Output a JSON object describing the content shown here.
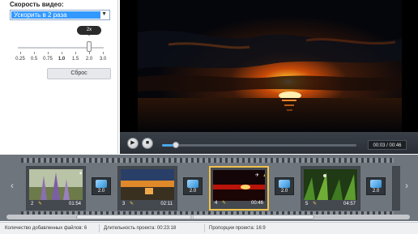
{
  "settings": {
    "speed_label": "Скорость видео:",
    "speed_value": "Ускорить в 2 раза",
    "tooltip": "2x",
    "scale": [
      "0.25",
      "0.5",
      "0.75",
      "1.0",
      "1.5",
      "2.0",
      "3.0"
    ],
    "reset_label": "Сброс"
  },
  "player": {
    "time": "00:03 / 00:46",
    "progress": 0.07
  },
  "storyboard": {
    "clips": [
      {
        "number": "2",
        "duration": "01:54"
      },
      {
        "number": "3",
        "duration": "02:11"
      },
      {
        "number": "4",
        "duration": "00:46"
      },
      {
        "number": "5",
        "duration": "04:57"
      }
    ],
    "transitions": [
      "2.0",
      "2.0",
      "2.0",
      "2.0"
    ],
    "active_clip": "4"
  },
  "status": {
    "files": "Количество добавленных файлов: 6",
    "duration": "Длительность проекта: 00:23:18",
    "ratio": "Пропорции проекта: 16:9"
  }
}
